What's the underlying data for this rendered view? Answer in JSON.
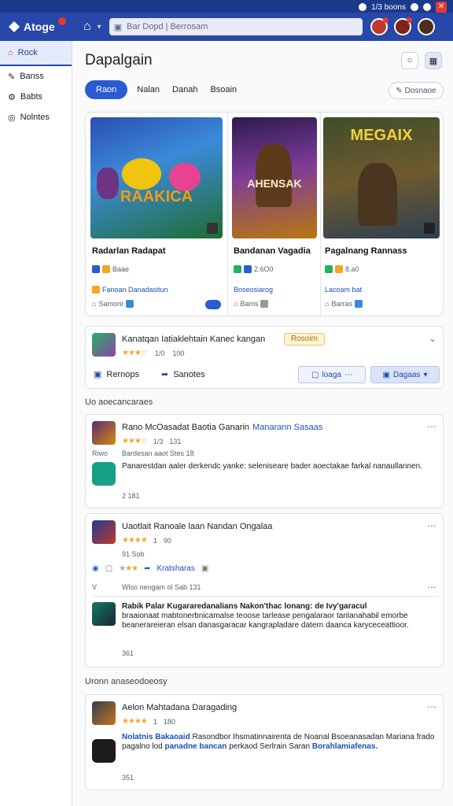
{
  "statusbar": {
    "text": "1/3 boons"
  },
  "topbar": {
    "logo": "Atoge",
    "search_text": "Bar Dopd | Berrosam"
  },
  "sidebar": {
    "items": [
      "Rock",
      "Banss",
      "Babts",
      "Nolntes"
    ]
  },
  "main": {
    "title": "Dapalgain",
    "tabs": [
      "Raon",
      "Nalan",
      "Danah",
      "Bsoain"
    ],
    "right_button": "Dosnaoe"
  },
  "game_cards": [
    {
      "banner": "RAAKICA",
      "title": "Radarlan Radapat",
      "meta": "Baae",
      "link": "Fanoan  Danadasitun",
      "footer": "Samore"
    },
    {
      "banner": "AHENSAK",
      "title": "Bandanan Vagadia",
      "meta": "2.6O0",
      "link": "Boseosiarog",
      "footer": "Bams"
    },
    {
      "banner": "MEGAIX",
      "title": "Pagalnang Rannass",
      "meta": "8.a0",
      "link": "Lacoam bat",
      "footer": "Barras"
    }
  ],
  "featured": {
    "title": "Kanatqan Iatiaklehtain Kanec kangan",
    "badge": "Rosoim",
    "rating": "1/0",
    "rating_count": "100",
    "action_1": "Rernops",
    "action_2": "Sanotes",
    "button_1": "loaga",
    "button_2": "Dagaas"
  },
  "section_1": {
    "label": "Uo aoecancaraes"
  },
  "review_1": {
    "title": "Rano McOasadat Baotia Ganarin",
    "title_link": "Manarann Sasaas",
    "rating": "1/3",
    "rating_count": "131",
    "side_label": "Riwo",
    "sub": "Bardesan aaot Stes 18",
    "body": "Panarestdan aaler derkendc yanke: seleniseare bader aoectakae farkal nanaullannen.",
    "footer": "2  181"
  },
  "review_2": {
    "title": "Uaotlait Ranoale laan Nandan Ongalaa",
    "rating": "1",
    "rating_count": "90",
    "sub": "91  Sob",
    "tags_link": "Kratsharas",
    "side_label": "V",
    "sub2": "Wlso nengam ol Sab 131",
    "reply_title": "Rabik Palar Kugararedanalians Nakon'thac lonang: de Ivy'garacul",
    "reply_body": "braaionaat mabtonerbnicamalse teoose tarlease pengalaraor tanlanahabil emorbe beanerareieran elsan  danasgaracar kangrapladare datern daanca karyceceattioor.",
    "reply_footer": "361"
  },
  "section_2": {
    "label": "Uronn anaseodoeosy"
  },
  "review_3": {
    "title": "Aelon Mahtadana Daragading",
    "rating": "1",
    "rating_count": "180",
    "body_link_1": "Nolatnis Bakaoaid",
    "body_text_1": "Rasondbor Ihsmatinnairenta de Noanal Bsoeanasadan",
    "body_text_2": "Mariana frado pagalno lod",
    "body_link_2": "panadne bancan",
    "body_text_3": "perkaod Serlrain Saran",
    "body_link_3": "Borahlamiafenas.",
    "footer": "351"
  },
  "colors": {
    "topbar": "#2748a8",
    "accent": "#2b5ad1",
    "statusbar": "#1b3a8c",
    "star": "#f5a623",
    "link": "#1b4fbf"
  }
}
